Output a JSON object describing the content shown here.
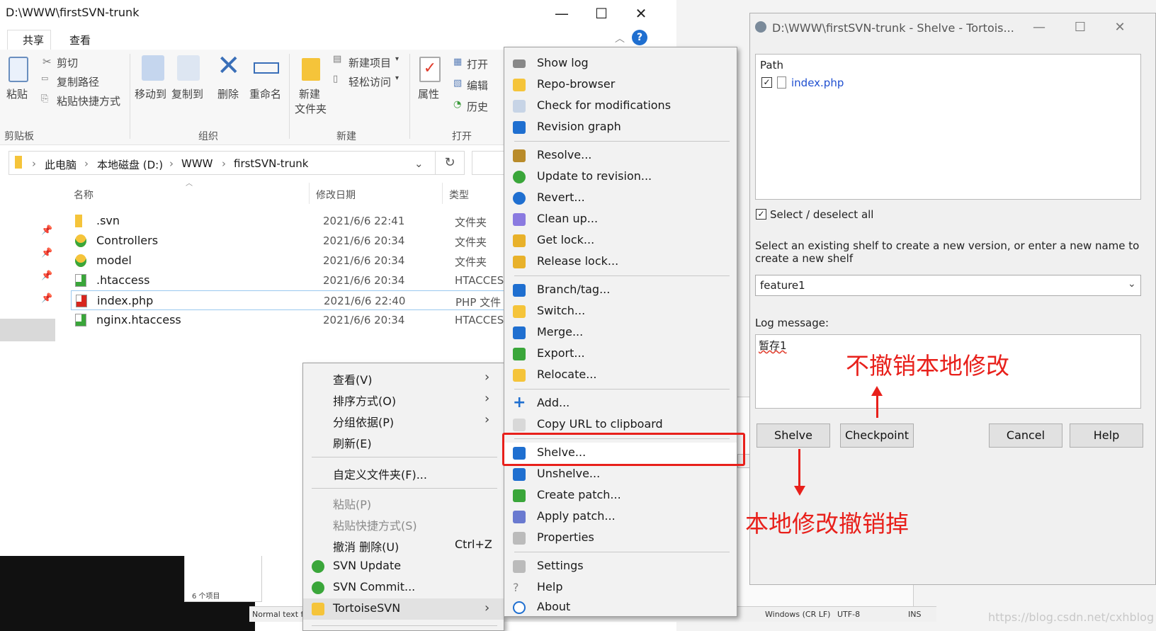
{
  "explorer": {
    "title": "D:\\WWW\\firstSVN-trunk",
    "window_buttons": [
      "—",
      "☐",
      "✕"
    ],
    "menu_tabs": [
      "共享",
      "查看"
    ],
    "ribbon": {
      "paste": "粘贴",
      "cut": "剪切",
      "copy_path": "复制路径",
      "paste_shortcut": "粘贴快捷方式",
      "move_to": "移动到",
      "copy_to": "复制到",
      "delete": "删除",
      "rename": "重命名",
      "new_folder_1": "新建",
      "new_folder_2": "文件夹",
      "new_item": "新建项目",
      "easy_access": "轻松访问",
      "properties": "属性",
      "open": "打开",
      "edit": "编辑",
      "history": "历史",
      "groups": {
        "clipboard": "剪贴板",
        "organize": "组织",
        "new": "新建",
        "open": "打开"
      }
    },
    "address": {
      "pc": "此电脑",
      "disk": "本地磁盘 (D:)",
      "www": "WWW",
      "folder": "firstSVN-trunk"
    },
    "columns": {
      "name": "名称",
      "date": "修改日期",
      "type": "类型"
    },
    "files": [
      {
        "name": ".svn",
        "date": "2021/6/6 22:41",
        "type": "文件夹"
      },
      {
        "name": "Controllers",
        "date": "2021/6/6 20:34",
        "type": "文件夹"
      },
      {
        "name": "model",
        "date": "2021/6/6 20:34",
        "type": "文件夹"
      },
      {
        "name": ".htaccess",
        "date": "2021/6/6 20:34",
        "type": "HTACCESS"
      },
      {
        "name": "index.php",
        "date": "2021/6/6 22:40",
        "type": "PHP 文件"
      },
      {
        "name": "nginx.htaccess",
        "date": "2021/6/6 20:34",
        "type": "HTACCESS"
      }
    ],
    "item_count": "6 个项目"
  },
  "context_menu": {
    "view": "查看(V)",
    "sort": "排序方式(O)",
    "group": "分组依据(P)",
    "refresh": "刷新(E)",
    "customize": "自定义文件夹(F)...",
    "paste": "粘贴(P)",
    "paste_shortcut": "粘贴快捷方式(S)",
    "undo_delete": "撤消 删除(U)",
    "undo_shortcut": "Ctrl+Z",
    "svn_update": "SVN Update",
    "svn_commit": "SVN Commit...",
    "tortoise": "TortoiseSVN"
  },
  "svn_menu": {
    "show_log": "Show log",
    "repo_browser": "Repo-browser",
    "check_mod": "Check for modifications",
    "rev_graph": "Revision graph",
    "resolve": "Resolve...",
    "update_rev": "Update to revision...",
    "revert": "Revert...",
    "cleanup": "Clean up...",
    "get_lock": "Get lock...",
    "release_lock": "Release lock...",
    "branch": "Branch/tag...",
    "switch": "Switch...",
    "merge": "Merge...",
    "export": "Export...",
    "relocate": "Relocate...",
    "add": "Add...",
    "copy_url": "Copy URL to clipboard",
    "shelve": "Shelve...",
    "unshelve": "Unshelve...",
    "create_patch": "Create patch...",
    "apply_patch": "Apply patch...",
    "properties": "Properties",
    "settings": "Settings",
    "help": "Help",
    "about": "About"
  },
  "shelve_dialog": {
    "title": "D:\\WWW\\firstSVN-trunk - Shelve - Tortois...",
    "path_header": "Path",
    "file": "index.php",
    "select_all": "Select / deselect all",
    "instruction": "Select an existing shelf to create a new version, or enter a new name to create a new shelf",
    "instruction_1": "Select an existing shelf to create a new version, or enter a new name to",
    "instruction_2": "create a new shelf",
    "shelf_name": "feature1",
    "log_label": "Log message:",
    "log_value": "暂存1",
    "buttons": {
      "shelve": "Shelve",
      "checkpoint": "Checkpoint",
      "cancel": "Cancel",
      "help": "Help"
    }
  },
  "annotations": {
    "checkpoint_note": "不撤销本地修改",
    "shelve_note": "本地修改撤销掉"
  },
  "background": {
    "status_normal": "Normal text f",
    "status_line_end": "Windows (CR LF)",
    "status_encoding": "UTF-8",
    "status_ins": "INS",
    "watermark": "https://blog.csdn.net/cxhblog"
  },
  "colors": {
    "annotation_red": "#e8201b",
    "svn_blue": "#1f6fd0",
    "highlight": "#cce8ff"
  }
}
